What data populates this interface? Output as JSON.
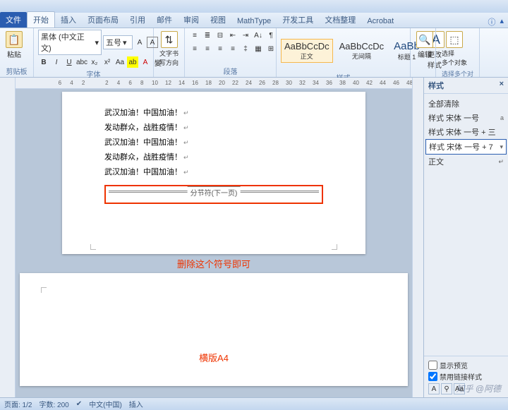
{
  "tabs": {
    "file": "文件",
    "items": [
      "开始",
      "插入",
      "页面布局",
      "引用",
      "邮件",
      "审阅",
      "视图",
      "MathType",
      "开发工具",
      "文档整理",
      "Acrobat"
    ],
    "active_index": 0
  },
  "ribbon": {
    "clipboard": {
      "label": "剪贴板",
      "paste": "粘贴"
    },
    "font": {
      "label": "字体",
      "family": "黑体 (中文正文)",
      "size": "五号",
      "bold": "B",
      "italic": "I",
      "underline": "U"
    },
    "text_direction": {
      "label": "文字方向",
      "btn": "文字书\n写方向"
    },
    "paragraph": {
      "label": "段落"
    },
    "styles": {
      "label": "样式",
      "items": [
        {
          "preview": "AaBbCcDc",
          "name": "正文"
        },
        {
          "preview": "AaBbCcDc",
          "name": "无间隔"
        },
        {
          "preview": "AaBb",
          "name": "标题 1"
        }
      ],
      "change": "更改样式"
    },
    "editing": {
      "label": "编辑",
      "find": "A",
      "edit": "编辑"
    },
    "select": {
      "label": "选择多个对象",
      "btn": "选择\n多个对象"
    }
  },
  "ruler_marks": [
    "6",
    "4",
    "2",
    "",
    "2",
    "4",
    "6",
    "8",
    "10",
    "12",
    "14",
    "16",
    "18",
    "20",
    "22",
    "24",
    "26",
    "28",
    "30",
    "32",
    "34",
    "36",
    "38",
    "40",
    "42",
    "44",
    "46",
    "48"
  ],
  "document": {
    "lines": [
      "武汉加油！中国加油！",
      "发动群众，战胜疫情！",
      "武汉加油！中国加油！",
      "发动群众，战胜疫情！",
      "武汉加油！中国加油！"
    ],
    "section_break": "分节符(下一页)",
    "annotation1": "删除这个符号即可",
    "annotation2": "横版A4"
  },
  "styles_pane": {
    "title": "样式",
    "clear_all": "全部清除",
    "rows": [
      {
        "name": "样式 宋体 一号",
        "mark": "a"
      },
      {
        "name": "样式 宋体 一号 + 三",
        "mark": ""
      },
      {
        "name": "样式 宋体 一号 + 7",
        "mark": "",
        "selected": true
      },
      {
        "name": "正文",
        "mark": "↵"
      }
    ],
    "show_preview": "显示预览",
    "disable_linked": "禁用链接样式"
  },
  "statusbar": {
    "page": "页面: 1/2",
    "words": "字数: 200",
    "lang": "中文(中国)",
    "mode": "插入"
  },
  "watermark": "知乎 @阿德"
}
